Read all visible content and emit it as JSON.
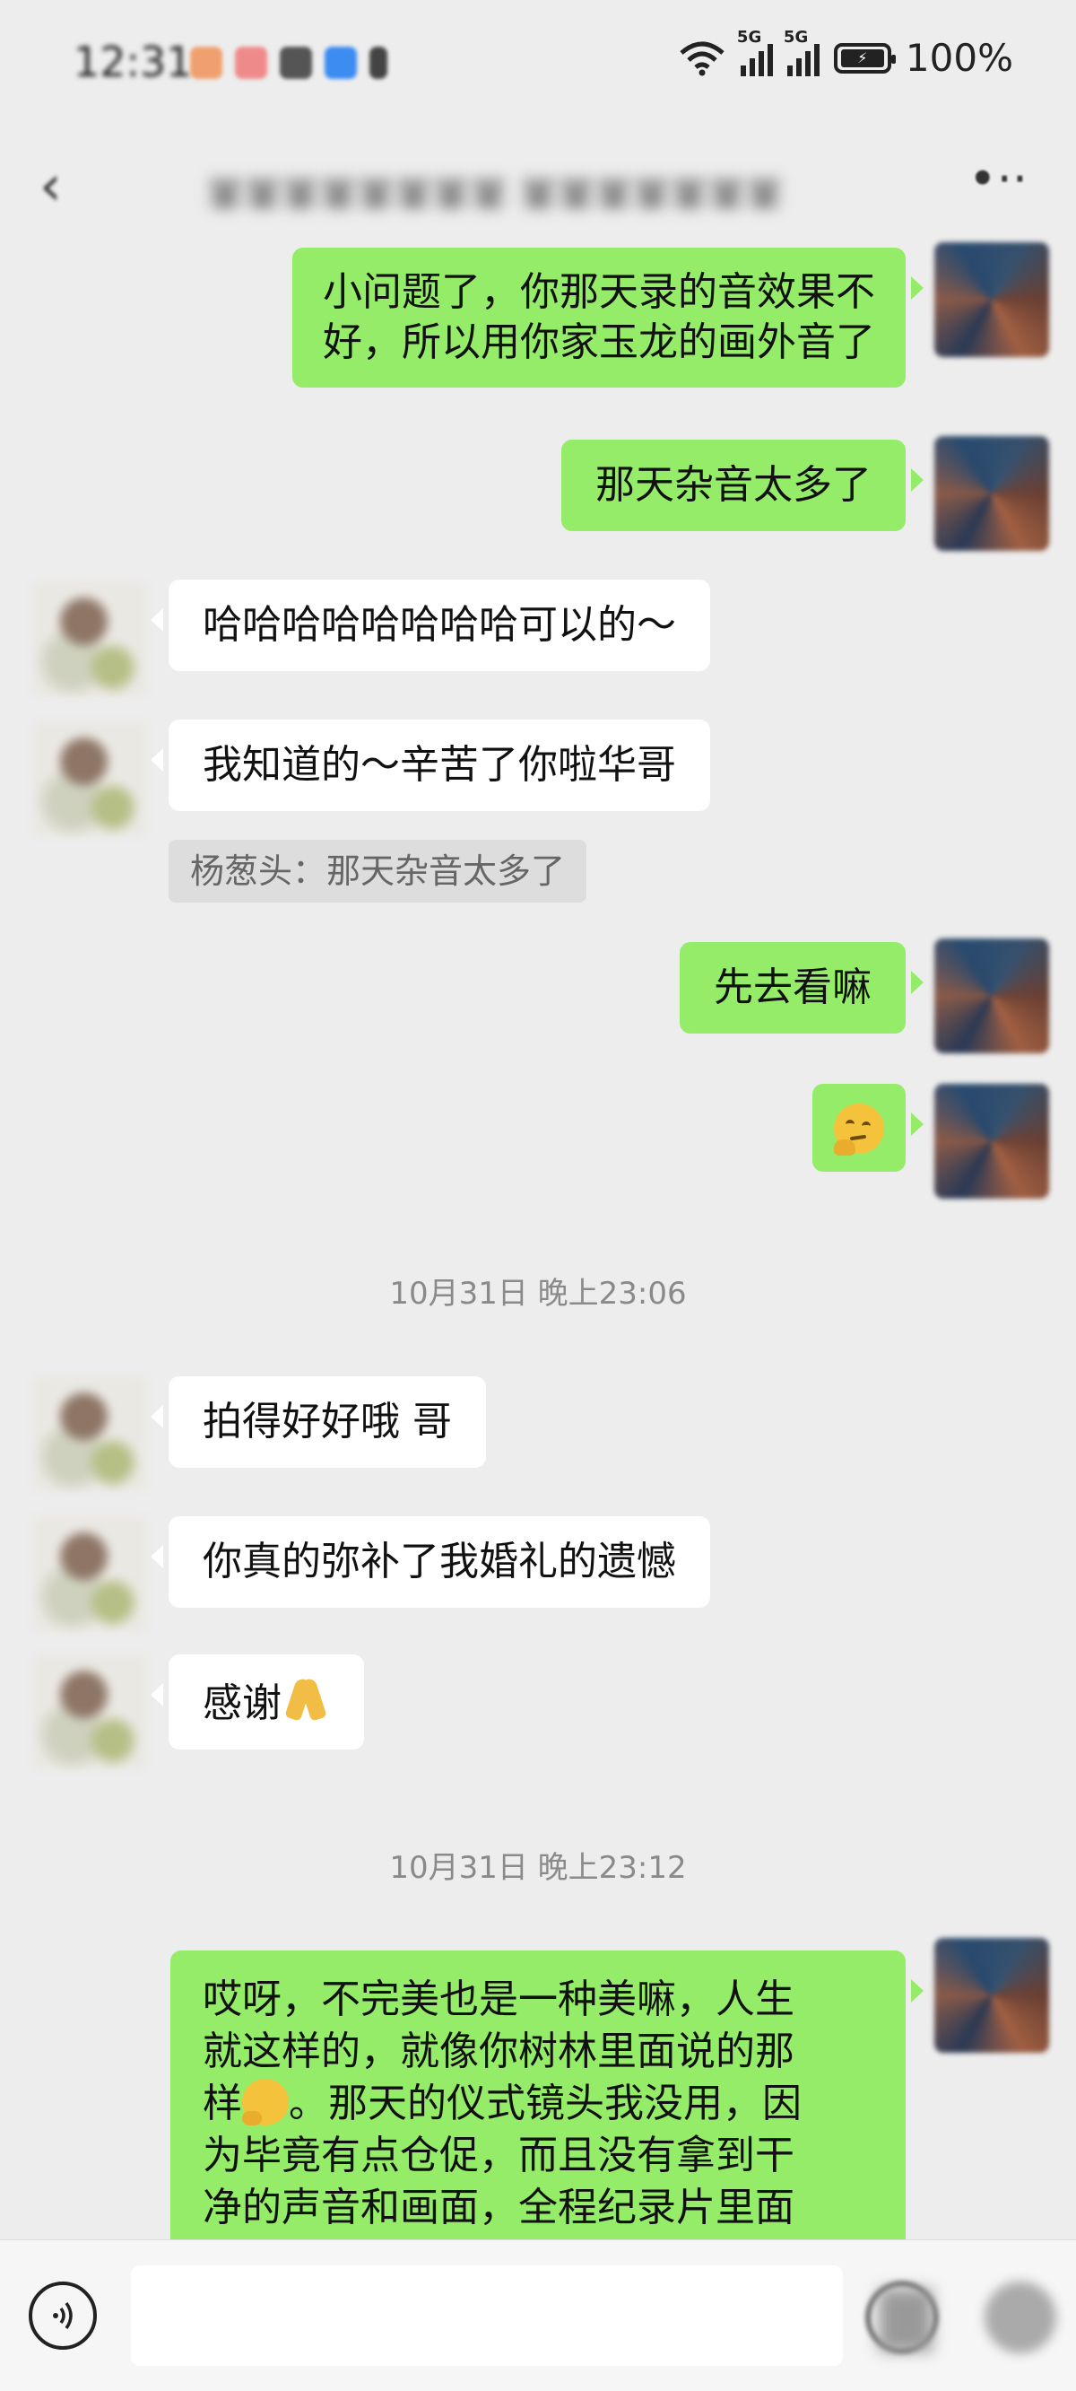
{
  "status_bar": {
    "time": "12:31",
    "network_1": "5G",
    "network_2": "5G",
    "battery": "100%"
  },
  "nav": {
    "title": "某某某某某某某某 某某某某某某某",
    "back_icon": "chevron-left-icon",
    "more_icon": "more-icon"
  },
  "messages": [
    {
      "side": "me",
      "lines": [
        "小问题了，你那天录的音效果不",
        "好，所以用你家玉龙的画外音了"
      ]
    },
    {
      "side": "me",
      "text": "那天杂音太多了"
    },
    {
      "side": "them",
      "text": "哈哈哈哈哈哈哈哈可以的～"
    },
    {
      "side": "them",
      "text": "我知道的～辛苦了你啦华哥"
    },
    {
      "quote": "杨葱头：那天杂音太多了"
    },
    {
      "side": "me",
      "text": "先去看嘛"
    },
    {
      "side": "me",
      "emoji": "thinking-emoji"
    },
    {
      "timestamp": "10月31日 晚上23:06"
    },
    {
      "side": "them",
      "text": "拍得好好哦 哥"
    },
    {
      "side": "them",
      "text": "你真的弥补了我婚礼的遗憾"
    },
    {
      "side": "them",
      "text": "感谢",
      "emoji": "pray-emoji"
    },
    {
      "timestamp": "10月31日 晚上23:12"
    },
    {
      "side": "me",
      "lines": [
        "哎呀，不完美也是一种美嘛，人生",
        "就这样的，就像你树林里面说的那",
        "样",
        "。那天的仪式镜头我没用，因",
        "为毕竟有点仓促，而且没有拿到干",
        "净的声音和画面，全程纪录片里面"
      ]
    }
  ],
  "input": {
    "voice_icon": "voice-icon",
    "emoji_icon": "emoji-icon",
    "plus_icon": "plus-icon"
  }
}
